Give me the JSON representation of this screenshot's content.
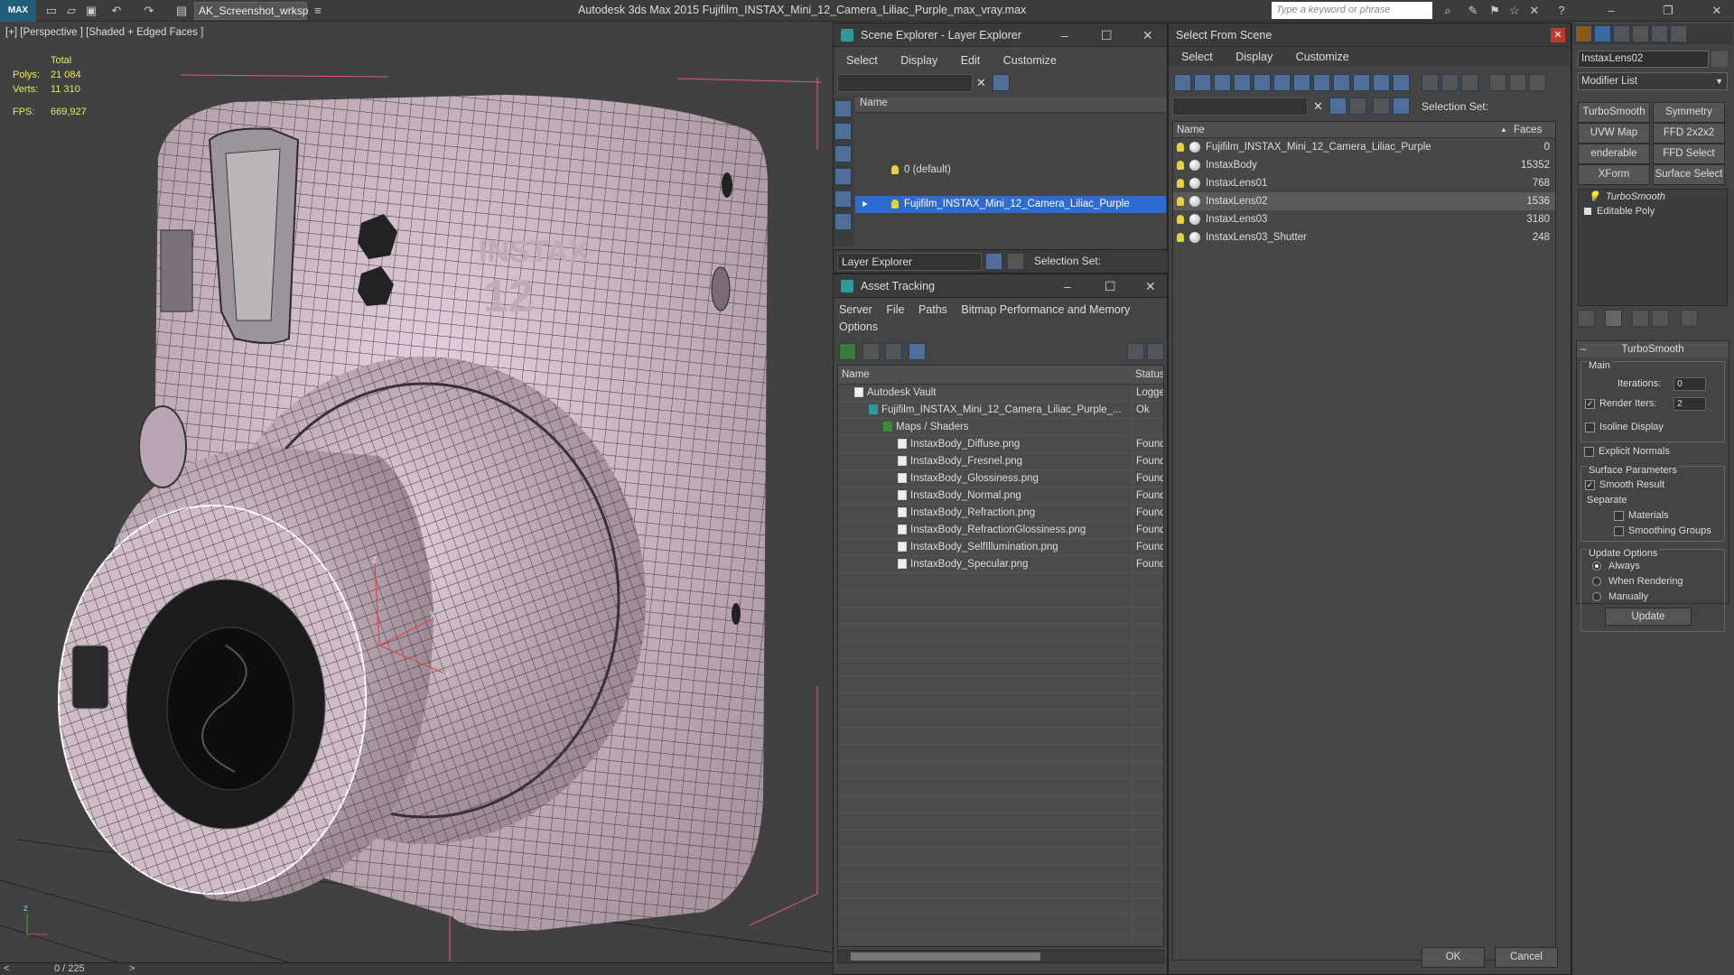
{
  "app": {
    "title": "Autodesk 3ds Max  2015    Fujifilm_INSTAX_Mini_12_Camera_Liliac_Purple_max_vray.max",
    "logo": "MAX",
    "workspace": "AK_Screenshot_wrksp",
    "search_placeholder": "Type a keyword or phrase"
  },
  "viewport": {
    "label": "[+] [Perspective ] [Shaded + Edged Faces ]",
    "stats": {
      "total_label": "Total",
      "polys_label": "Polys:",
      "polys_value": "21 084",
      "verts_label": "Verts:",
      "verts_value": "11 310",
      "fps_label": "FPS:",
      "fps_value": "669,927"
    },
    "model_text_1": "INSTAX",
    "model_text_2": "12"
  },
  "timeline": {
    "frame": "0 / 225"
  },
  "layer_explorer": {
    "title": "Scene Explorer - Layer Explorer",
    "menu": [
      "Select",
      "Display",
      "Edit",
      "Customize"
    ],
    "col_name": "Name",
    "layers": [
      "0 (default)",
      "Fujifilm_INSTAX_Mini_12_Camera_Liliac_Purple"
    ],
    "footer_label": "Layer Explorer",
    "selection_set": "Selection Set:"
  },
  "asset_tracking": {
    "title": "Asset Tracking",
    "menu": [
      "Server",
      "File",
      "Paths",
      "Bitmap Performance and Memory"
    ],
    "menu2": "Options",
    "col_name": "Name",
    "col_status": "Status",
    "rows": [
      {
        "name": "Autodesk Vault",
        "status": "Logged",
        "indent": 0
      },
      {
        "name": "Fujifilm_INSTAX_Mini_12_Camera_Liliac_Purple_...",
        "status": "Ok",
        "indent": 1
      },
      {
        "name": "Maps / Shaders",
        "status": "",
        "indent": 2
      },
      {
        "name": "InstaxBody_Diffuse.png",
        "status": "Found",
        "indent": 3
      },
      {
        "name": "InstaxBody_Fresnel.png",
        "status": "Found",
        "indent": 3
      },
      {
        "name": "InstaxBody_Glossiness.png",
        "status": "Found",
        "indent": 3
      },
      {
        "name": "InstaxBody_Normal.png",
        "status": "Found",
        "indent": 3
      },
      {
        "name": "InstaxBody_Refraction.png",
        "status": "Found",
        "indent": 3
      },
      {
        "name": "InstaxBody_RefractionGlossiness.png",
        "status": "Found",
        "indent": 3
      },
      {
        "name": "InstaxBody_SelfIllumination.png",
        "status": "Found",
        "indent": 3
      },
      {
        "name": "InstaxBody_Specular.png",
        "status": "Found",
        "indent": 3
      }
    ]
  },
  "select_from_scene": {
    "title": "Select From Scene",
    "menu": [
      "Select",
      "Display",
      "Customize"
    ],
    "selection_set": "Selection Set:",
    "col_name": "Name",
    "col_faces": "Faces",
    "rows": [
      {
        "name": "Fujifilm_INSTAX_Mini_12_Camera_Liliac_Purple",
        "faces": "0"
      },
      {
        "name": "InstaxBody",
        "faces": "15352"
      },
      {
        "name": "InstaxLens01",
        "faces": "768"
      },
      {
        "name": "InstaxLens02",
        "faces": "1536"
      },
      {
        "name": "InstaxLens03",
        "faces": "3180"
      },
      {
        "name": "InstaxLens03_Shutter",
        "faces": "248"
      }
    ],
    "ok": "OK",
    "cancel": "Cancel"
  },
  "command_panel": {
    "object_name": "InstaxLens02",
    "modifier_list": "Modifier List",
    "buttons": [
      "TurboSmooth",
      "Symmetry",
      "UVW Map",
      "FFD 2x2x2",
      "enderable Splin",
      "FFD Select",
      "XForm",
      "Surface Select"
    ],
    "stack": [
      "TurboSmooth",
      "Editable Poly"
    ],
    "rollout": "TurboSmooth",
    "main": "Main",
    "iterations_label": "Iterations:",
    "iterations": "0",
    "render_iters_label": "Render Iters:",
    "render_iters": "2",
    "isoline": "Isoline Display",
    "explicit_normals": "Explicit Normals",
    "surface_params": "Surface Parameters",
    "smooth_result": "Smooth Result",
    "separate": "Separate",
    "materials": "Materials",
    "smoothing_groups": "Smoothing Groups",
    "update_options": "Update Options",
    "always": "Always",
    "when_rendering": "When Rendering",
    "manually": "Manually",
    "update": "Update"
  }
}
